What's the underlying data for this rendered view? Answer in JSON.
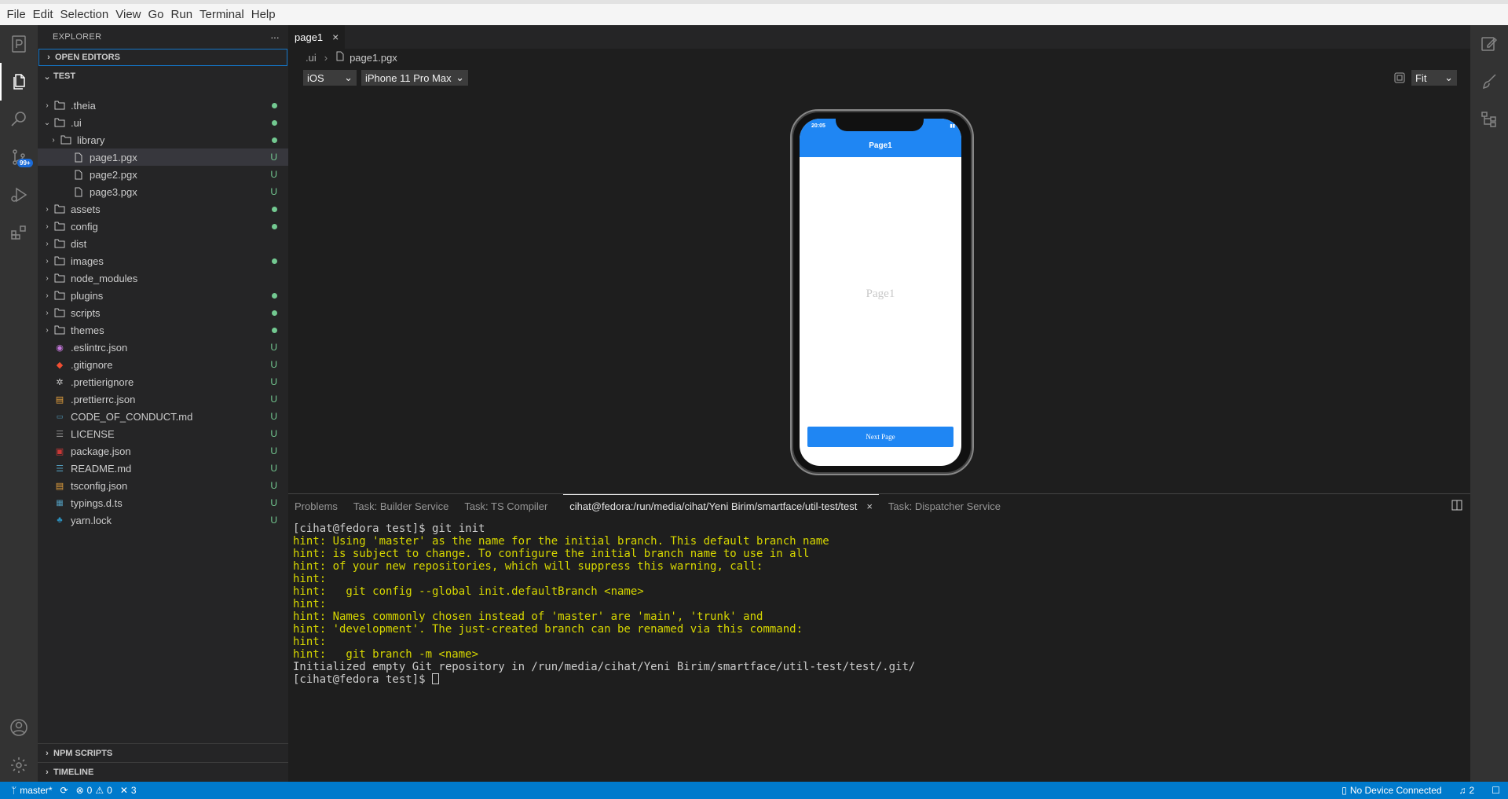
{
  "menu": [
    "File",
    "Edit",
    "Selection",
    "View",
    "Go",
    "Run",
    "Terminal",
    "Help"
  ],
  "activity": {
    "badge": "99+"
  },
  "explorer": {
    "title": "EXPLORER",
    "more": "···",
    "open_editors": "OPEN EDITORS",
    "root": "TEST",
    "items": [
      {
        "label": ".theia",
        "type": "folder",
        "indent": 0,
        "chev": "›",
        "deco": "dot"
      },
      {
        "label": ".ui",
        "type": "folder",
        "indent": 0,
        "chev": "⌄",
        "deco": "dot"
      },
      {
        "label": "library",
        "type": "folder",
        "indent": 1,
        "chev": "›",
        "deco": "dot"
      },
      {
        "label": "page1.pgx",
        "type": "file",
        "indent": 1,
        "deco": "U",
        "selected": true
      },
      {
        "label": "page2.pgx",
        "type": "file",
        "indent": 1,
        "deco": "U"
      },
      {
        "label": "page3.pgx",
        "type": "file",
        "indent": 1,
        "deco": "U"
      },
      {
        "label": "assets",
        "type": "folder",
        "indent": 0,
        "chev": "›",
        "deco": "dot"
      },
      {
        "label": "config",
        "type": "folder",
        "indent": 0,
        "chev": "›",
        "deco": "dot"
      },
      {
        "label": "dist",
        "type": "folder",
        "indent": 0,
        "chev": "›",
        "deco": ""
      },
      {
        "label": "images",
        "type": "folder",
        "indent": 0,
        "chev": "›",
        "deco": "dot"
      },
      {
        "label": "node_modules",
        "type": "folder",
        "indent": 0,
        "chev": "›",
        "deco": ""
      },
      {
        "label": "plugins",
        "type": "folder",
        "indent": 0,
        "chev": "›",
        "deco": "dot"
      },
      {
        "label": "scripts",
        "type": "folder",
        "indent": 0,
        "chev": "›",
        "deco": "dot"
      },
      {
        "label": "themes",
        "type": "folder",
        "indent": 0,
        "chev": "›",
        "deco": "dot"
      },
      {
        "label": ".eslintrc.json",
        "type": "eslint",
        "indent": 0,
        "deco": "U"
      },
      {
        "label": ".gitignore",
        "type": "git",
        "indent": 0,
        "deco": "U"
      },
      {
        "label": ".prettierignore",
        "type": "gear",
        "indent": 0,
        "deco": "U"
      },
      {
        "label": ".prettierrc.json",
        "type": "json",
        "indent": 0,
        "deco": "U"
      },
      {
        "label": "CODE_OF_CONDUCT.md",
        "type": "md",
        "indent": 0,
        "deco": "U"
      },
      {
        "label": "LICENSE",
        "type": "license",
        "indent": 0,
        "deco": "U"
      },
      {
        "label": "package.json",
        "type": "npm",
        "indent": 0,
        "deco": "U"
      },
      {
        "label": "README.md",
        "type": "readme",
        "indent": 0,
        "deco": "U"
      },
      {
        "label": "tsconfig.json",
        "type": "json",
        "indent": 0,
        "deco": "U"
      },
      {
        "label": "typings.d.ts",
        "type": "ts",
        "indent": 0,
        "deco": "U"
      },
      {
        "label": "yarn.lock",
        "type": "yarn",
        "indent": 0,
        "deco": "U"
      }
    ],
    "npm_scripts": "NPM SCRIPTS",
    "timeline": "TIMELINE"
  },
  "editor": {
    "tab": "page1",
    "breadcrumb": [
      ".ui",
      "page1.pgx"
    ],
    "os": "iOS",
    "device": "iPhone 11 Pro Max",
    "zoom": "Fit",
    "phone": {
      "time": "20:05",
      "nav_title": "Page1",
      "page_label": "Page1",
      "button": "Next Page"
    }
  },
  "panel": {
    "tabs": [
      "Problems",
      "Task: Builder Service",
      "Task: TS Compiler",
      "cihat@fedora:/run/media/cihat/Yeni Birim/smartface/util-test/test",
      "Task: Dispatcher Service"
    ],
    "active_tab": 3,
    "terminal": [
      {
        "t": "[cihat@fedora test]$ git init",
        "c": "n"
      },
      {
        "t": "hint: Using 'master' as the name for the initial branch. This default branch name",
        "c": "y"
      },
      {
        "t": "hint: is subject to change. To configure the initial branch name to use in all",
        "c": "y"
      },
      {
        "t": "hint: of your new repositories, which will suppress this warning, call:",
        "c": "y"
      },
      {
        "t": "hint:",
        "c": "y"
      },
      {
        "t": "hint:   git config --global init.defaultBranch <name>",
        "c": "y"
      },
      {
        "t": "hint:",
        "c": "y"
      },
      {
        "t": "hint: Names commonly chosen instead of 'master' are 'main', 'trunk' and",
        "c": "y"
      },
      {
        "t": "hint: 'development'. The just-created branch can be renamed via this command:",
        "c": "y"
      },
      {
        "t": "hint:",
        "c": "y"
      },
      {
        "t": "hint:   git branch -m <name>",
        "c": "y"
      },
      {
        "t": "Initialized empty Git repository in /run/media/cihat/Yeni Birim/smartface/util-test/test/.git/",
        "c": "n"
      },
      {
        "t": "[cihat@fedora test]$ ",
        "c": "n",
        "cursor": true
      }
    ]
  },
  "status": {
    "branch": "master*",
    "errors": "0",
    "warnings": "0",
    "ports": "3",
    "device": "No Device Connected",
    "notifications": "2"
  },
  "colors": {
    "accent": "#007acc",
    "brand_blue": "#1f86f3",
    "untracked": "#73c991",
    "hint": "#d7d700"
  }
}
